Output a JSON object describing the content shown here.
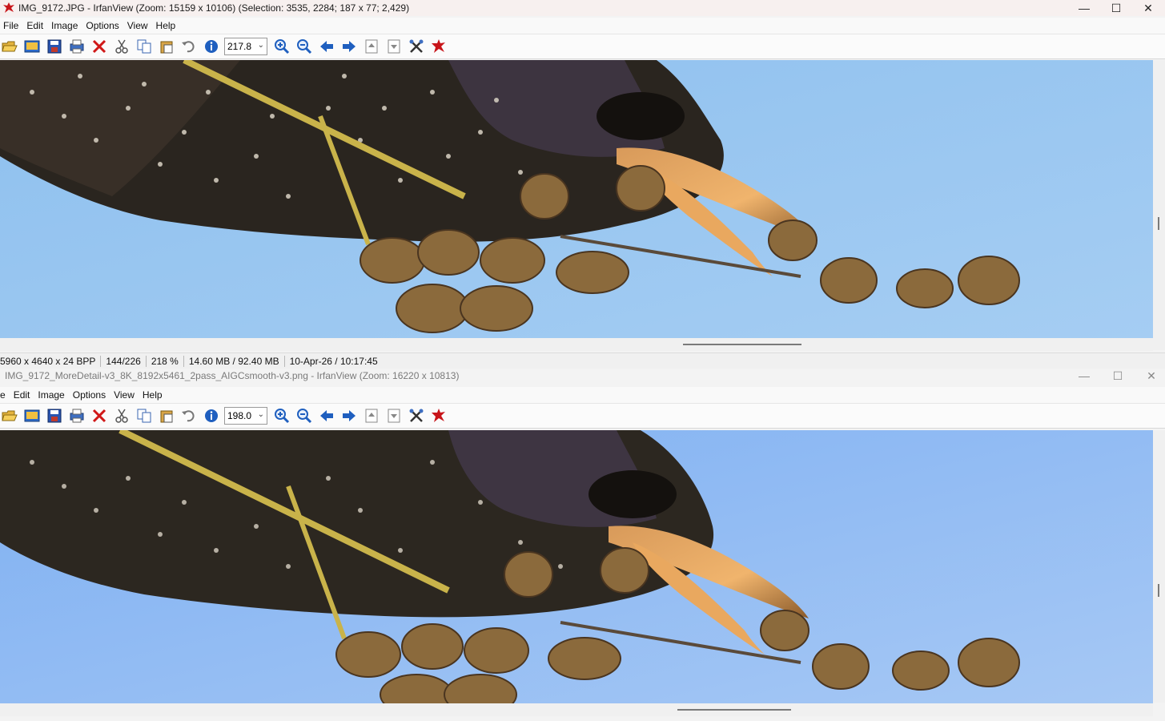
{
  "windows": [
    {
      "title": "IMG_9172.JPG - IrfanView (Zoom: 15159 x 10106) (Selection: 3535, 2284; 187 x 77; 2,429)",
      "menu": [
        "File",
        "Edit",
        "Image",
        "Options",
        "View",
        "Help"
      ],
      "zoom_value": "217.8",
      "status": [
        "5960 x 4640 x 24 BPP",
        "144/226",
        "218 %",
        "14.60 MB / 92.40 MB",
        "10-Apr-26 / 10:17:45"
      ]
    },
    {
      "title": "IMG_9172_MoreDetail-v3_8K_8192x5461_2pass_AIGCsmooth-v3.png - IrfanView (Zoom: 16220 x 10813)",
      "menu": [
        "e",
        "Edit",
        "Image",
        "Options",
        "View",
        "Help"
      ],
      "zoom_value": "198.0"
    }
  ],
  "window_controls": {
    "minimize": "—",
    "maximize": "☐",
    "close": "✕"
  },
  "toolbar_icons": [
    "open-icon",
    "slideshow-icon",
    "save-icon",
    "print-icon",
    "delete-icon",
    "cut-icon",
    "copy-icon",
    "paste-icon",
    "undo-icon",
    "info-icon",
    "zoom-in-icon",
    "zoom-out-icon",
    "prev-icon",
    "next-icon",
    "first-page-icon",
    "last-page-icon",
    "settings-icon",
    "exit-icon"
  ],
  "colors": {
    "sky": "#8fc0ef",
    "sky2": "#85b4f2",
    "plumage": "#2b2620",
    "beak": "#e7a868",
    "seed": "#8b6a3c"
  }
}
